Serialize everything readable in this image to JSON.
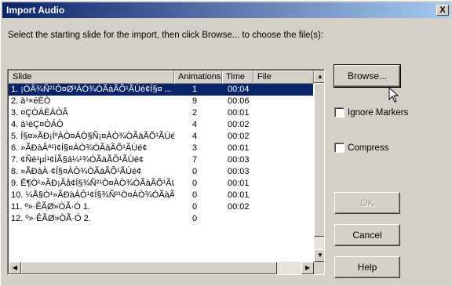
{
  "window": {
    "title": "Import Audio",
    "close_label": "X"
  },
  "instructions": "Select the starting slide for the import, then click Browse... to choose the file(s):",
  "table": {
    "columns": [
      "Slide",
      "Animations",
      "Time",
      "File"
    ],
    "rows": [
      {
        "slide": "1. ¡ÒÃ¾Ñ²¹Ò¤Ø³ÀÒ¾ÒÃàÃÕ¹ÃÙé¢Í§¤ ...",
        "animations": "1",
        "time": "00:04",
        "file": "",
        "selected": true
      },
      {
        "slide": "2. à¹×éËÒ",
        "animations": "9",
        "time": "00:06",
        "file": ""
      },
      {
        "slide": "3. ¤ÇÒÁËÁÒÂ",
        "animations": "2",
        "time": "00:01",
        "file": ""
      },
      {
        "slide": "4. á¹éÇ¤ÒÁÒ",
        "animations": "4",
        "time": "00:02",
        "file": ""
      },
      {
        "slide": "5. Í§¤»ÃÐ¡ÍºÀÒ¤ÁÒ§Ñ¡¤ÀÒ¾ÒÃàÃÕ¹ÃÙé¢",
        "animations": "4",
        "time": "00:02",
        "file": ""
      },
      {
        "slide": "6. »ÃÐàÂª¹ì¢Í§¤ÀÒ¾ÒÃàÃÕ¹ÃÙé¢",
        "animations": "3",
        "time": "00:01",
        "file": ""
      },
      {
        "slide": "7. ¢Ñé¹µÍ¹¢ÍÃ§á¼¹¾ÒÃàÃÕ¹ÃÙé¢",
        "animations": "7",
        "time": "00:03",
        "file": ""
      },
      {
        "slide": "8. »ÃÐàÀ·¢Í§¤ÀÒ¾ÒÃàÃÕ¹ÃÙé¢",
        "animations": "0",
        "time": "00:03",
        "file": ""
      },
      {
        "slide": "9. Ê¶Ò¹»ÃÐ¡Ãå¢Í§¾Ñ²¹Ò¤ÀÒ¾ÒÃàÃÕ¹ÃÙé ...",
        "animations": "0",
        "time": "00:01",
        "file": ""
      },
      {
        "slide": "10. ¼Å§Ò¹»ÃÐàÁÔ¹¢Í§¾Ñ²¹Ò¤ÀÒ¾ÒÃàÃÕ ...",
        "animations": "0",
        "time": "00:01",
        "file": ""
      },
      {
        "slide": "11. º»·ÊÃØ»ÒÃ·Ó 1.",
        "animations": "0",
        "time": "00:02",
        "file": ""
      },
      {
        "slide": "12. º»·ÊÃØ»ÒÃ·Ó 2.",
        "animations": "0",
        "time": "",
        "file": ""
      }
    ]
  },
  "buttons": {
    "browse": "Browse...",
    "ok": "OK",
    "cancel": "Cancel",
    "help": "Help"
  },
  "checkboxes": {
    "ignore_markers": {
      "label": "Ignore Markers",
      "checked": false
    },
    "compress": {
      "label": "Compress",
      "checked": false
    }
  },
  "scroll_icons": {
    "up": "▲",
    "down": "▼",
    "left": "◀",
    "right": "▶"
  }
}
